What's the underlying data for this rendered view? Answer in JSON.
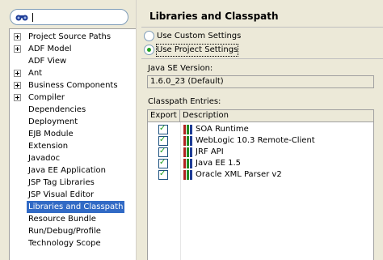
{
  "tree": {
    "items": [
      {
        "label": "Project Source Paths",
        "expandable": true
      },
      {
        "label": "ADF Model",
        "expandable": true
      },
      {
        "label": "ADF View",
        "expandable": false
      },
      {
        "label": "Ant",
        "expandable": true
      },
      {
        "label": "Business Components",
        "expandable": true
      },
      {
        "label": "Compiler",
        "expandable": true
      },
      {
        "label": "Dependencies",
        "expandable": false
      },
      {
        "label": "Deployment",
        "expandable": false
      },
      {
        "label": "EJB Module",
        "expandable": false
      },
      {
        "label": "Extension",
        "expandable": false
      },
      {
        "label": "Javadoc",
        "expandable": false
      },
      {
        "label": "Java EE Application",
        "expandable": false
      },
      {
        "label": "JSP Tag Libraries",
        "expandable": false
      },
      {
        "label": "JSP Visual Editor",
        "expandable": false
      },
      {
        "label": "Libraries and Classpath",
        "expandable": false,
        "selected": true
      },
      {
        "label": "Resource Bundle",
        "expandable": false
      },
      {
        "label": "Run/Debug/Profile",
        "expandable": false
      },
      {
        "label": "Technology Scope",
        "expandable": false
      }
    ]
  },
  "search": {
    "icon": "binoculars-icon",
    "value": ""
  },
  "page": {
    "title": "Libraries and Classpath",
    "radio_custom": "Use Custom Settings",
    "radio_project": "Use Project Settings",
    "java_se_label": "Java SE Version:",
    "java_se_value": "1.6.0_23 (Default)",
    "classpath_label": "Classpath Entries:"
  },
  "table": {
    "headers": {
      "export": "Export",
      "description": "Description"
    },
    "rows": [
      {
        "checked": true,
        "description": "SOA Runtime"
      },
      {
        "checked": true,
        "description": "WebLogic 10.3 Remote-Client"
      },
      {
        "checked": true,
        "description": "JRF API"
      },
      {
        "checked": true,
        "description": "Java EE 1.5"
      },
      {
        "checked": true,
        "description": "Oracle XML Parser v2"
      }
    ]
  },
  "colors": {
    "selection": "#316ac5",
    "radio_dot": "#21a121",
    "library_icon": [
      "#b22222",
      "#228b22",
      "#1e3c96"
    ]
  }
}
